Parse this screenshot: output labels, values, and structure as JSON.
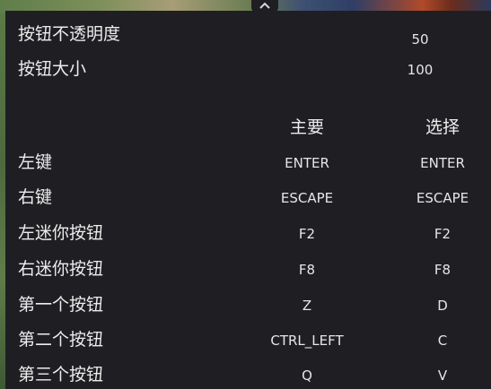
{
  "settings": {
    "opacity_label": "按钮不透明度",
    "opacity_value": "50",
    "size_label": "按钮大小",
    "size_value": "100"
  },
  "mapping": {
    "header_primary": "主要",
    "header_alternate": "选择",
    "rows": [
      {
        "label": "左键",
        "primary": "ENTER",
        "alternate": "ENTER"
      },
      {
        "label": "右键",
        "primary": "ESCAPE",
        "alternate": "ESCAPE"
      },
      {
        "label": "左迷你按钮",
        "primary": "F2",
        "alternate": "F2"
      },
      {
        "label": "右迷你按钮",
        "primary": "F8",
        "alternate": "F8"
      },
      {
        "label": "第一个按钮",
        "primary": "Z",
        "alternate": "D"
      },
      {
        "label": "第二个按钮",
        "primary": "CTRL_LEFT",
        "alternate": "C"
      },
      {
        "label": "第三个按钮",
        "primary": "Q",
        "alternate": "V"
      }
    ]
  },
  "toggle_icon": "chevron-up-icon",
  "colors": {
    "panel_bg": "#1f1f23",
    "text": "#ececec"
  }
}
